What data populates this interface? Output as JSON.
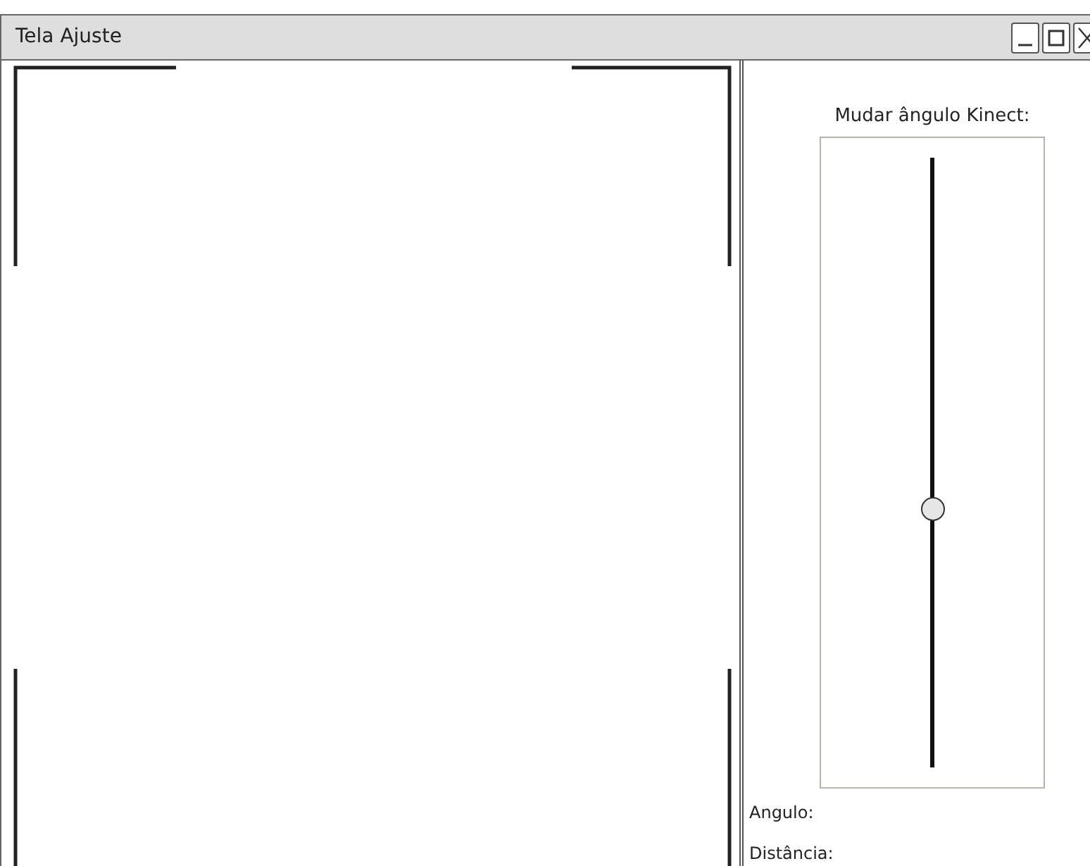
{
  "window": {
    "title": "Tela Ajuste"
  },
  "side_panel": {
    "label": "Mudar ângulo Kinect:",
    "slider": {
      "level": 0.43
    },
    "readouts": [
      "Angulo:",
      "Distância:"
    ]
  }
}
